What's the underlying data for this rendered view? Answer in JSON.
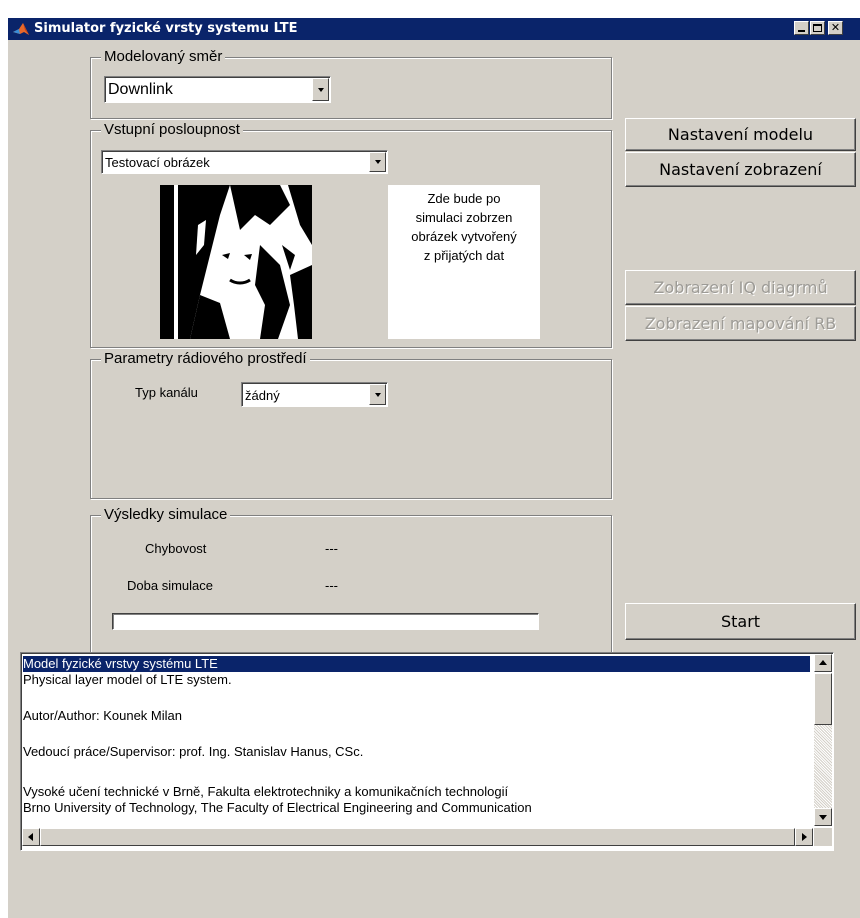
{
  "window": {
    "title": "Simulator fyzické vrsty systemu LTE",
    "controls": {
      "minimize": "_",
      "maximize": "□",
      "close": "✕"
    }
  },
  "direction_panel": {
    "title": "Modelovaný směr",
    "selected": "Downlink"
  },
  "input_panel": {
    "title": "Vstupní posloupnost",
    "selected": "Testovací obrázek",
    "placeholder_lines": [
      "Zde bude po",
      "simulaci zobrzen",
      "obrázek vytvořený",
      "z přijatých dat"
    ]
  },
  "radio_panel": {
    "title": "Parametry rádiového prostředí",
    "channel_label": "Typ kanálu",
    "channel_selected": "žádný"
  },
  "results_panel": {
    "title": "Výsledky simulace",
    "error_label": "Chybovost",
    "error_value": "---",
    "time_label": "Doba simulace",
    "time_value": "---",
    "progress": 0
  },
  "buttons": {
    "model_settings": "Nastavení modelu",
    "display_settings": "Nastavení zobrazení",
    "iq_diagrams": "Zobrazení IQ diagrmů",
    "rb_mapping": "Zobrazení mapování RB",
    "start": "Start"
  },
  "info_list": [
    "Model fyzické vrstvy systému LTE",
    "Physical layer model of LTE system.",
    "",
    "Autor/Author: Kounek Milan",
    "",
    "Vedoucí práce/Supervisor: prof. Ing. Stanislav Hanus, CSc.",
    "",
    "Vysoké učení technické v Brně, Fakulta elektrotechniky a komunikačních technologií",
    "Brno University of Technology, The Faculty of Electrical Engineering and Communication"
  ],
  "colors": {
    "window_bg": "#d4d0c8",
    "titlebar": "#0a246a",
    "selection": "#0a246a",
    "disabled_text": "#9d9b96"
  }
}
